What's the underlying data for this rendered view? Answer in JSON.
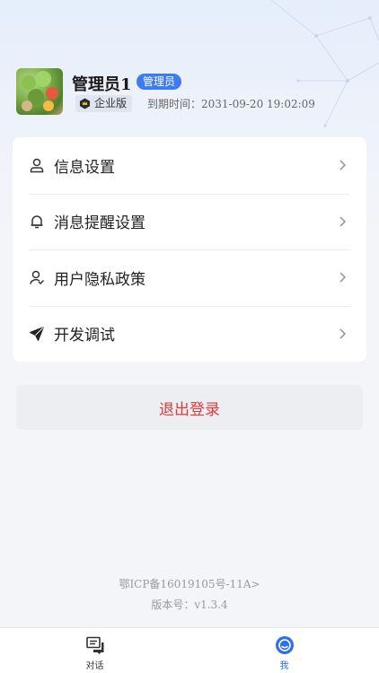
{
  "profile": {
    "name": "管理员1",
    "role_badge": "管理员",
    "edition": "企业版",
    "expire_label": "到期时间：",
    "expire_time": "2031-09-20 19:02:09"
  },
  "menu": {
    "items": [
      {
        "label": "信息设置",
        "icon": "user-icon"
      },
      {
        "label": "消息提醒设置",
        "icon": "bell-icon"
      },
      {
        "label": "用户隐私政策",
        "icon": "user-privacy-icon"
      },
      {
        "label": "开发调试",
        "icon": "send-icon"
      }
    ]
  },
  "logout": {
    "label": "退出登录"
  },
  "footer": {
    "icp": "鄂ICP备16019105号-11A>",
    "version": "版本号：v1.3.4"
  },
  "tabbar": {
    "tabs": [
      {
        "label": "对话",
        "icon": "chat-icon",
        "active": false
      },
      {
        "label": "我",
        "icon": "me-icon",
        "active": true
      }
    ]
  },
  "colors": {
    "accent": "#2f6fe8",
    "badge": "#3d7cf0",
    "logout_text": "#e33b3b"
  }
}
